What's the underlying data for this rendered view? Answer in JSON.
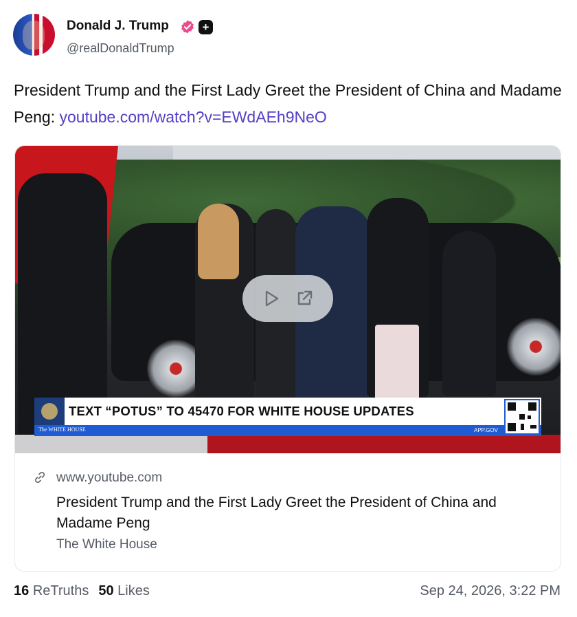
{
  "author": {
    "display_name": "Donald J. Trump",
    "handle": "@realDonaldTrump",
    "avatar_icon": "avatar-flag-portrait",
    "verified_icon": "verified-badge-icon",
    "verified_color": "#e84c8a",
    "extra_badge_icon": "plus-badge-icon"
  },
  "post": {
    "text": "President Trump and the First Lady Greet the President of China and Madame Peng: ",
    "link_text": "youtube.com/watch?v=EWdAEh9NeO",
    "link_color": "#5340c4"
  },
  "media": {
    "banner_text": "TEXT “POTUS” TO 45470 FOR WHITE HOUSE UPDATES",
    "banner_stripe_left": "The WHITE HOUSE",
    "banner_stripe_right": "APP.GOV",
    "banner_accent_color": "#1f5bd1",
    "play_icon": "play-icon",
    "external_icon": "external-link-icon"
  },
  "link_card": {
    "domain": "www.youtube.com",
    "domain_icon": "link-icon",
    "title": "President Trump and the First Lady Greet the President of China and Madame Peng",
    "author": "The White House"
  },
  "stats": {
    "retruths_count": "16",
    "retruths_label": "ReTruths",
    "likes_count": "50",
    "likes_label": "Likes",
    "timestamp": "Sep 24, 2026, 3:22 PM"
  }
}
